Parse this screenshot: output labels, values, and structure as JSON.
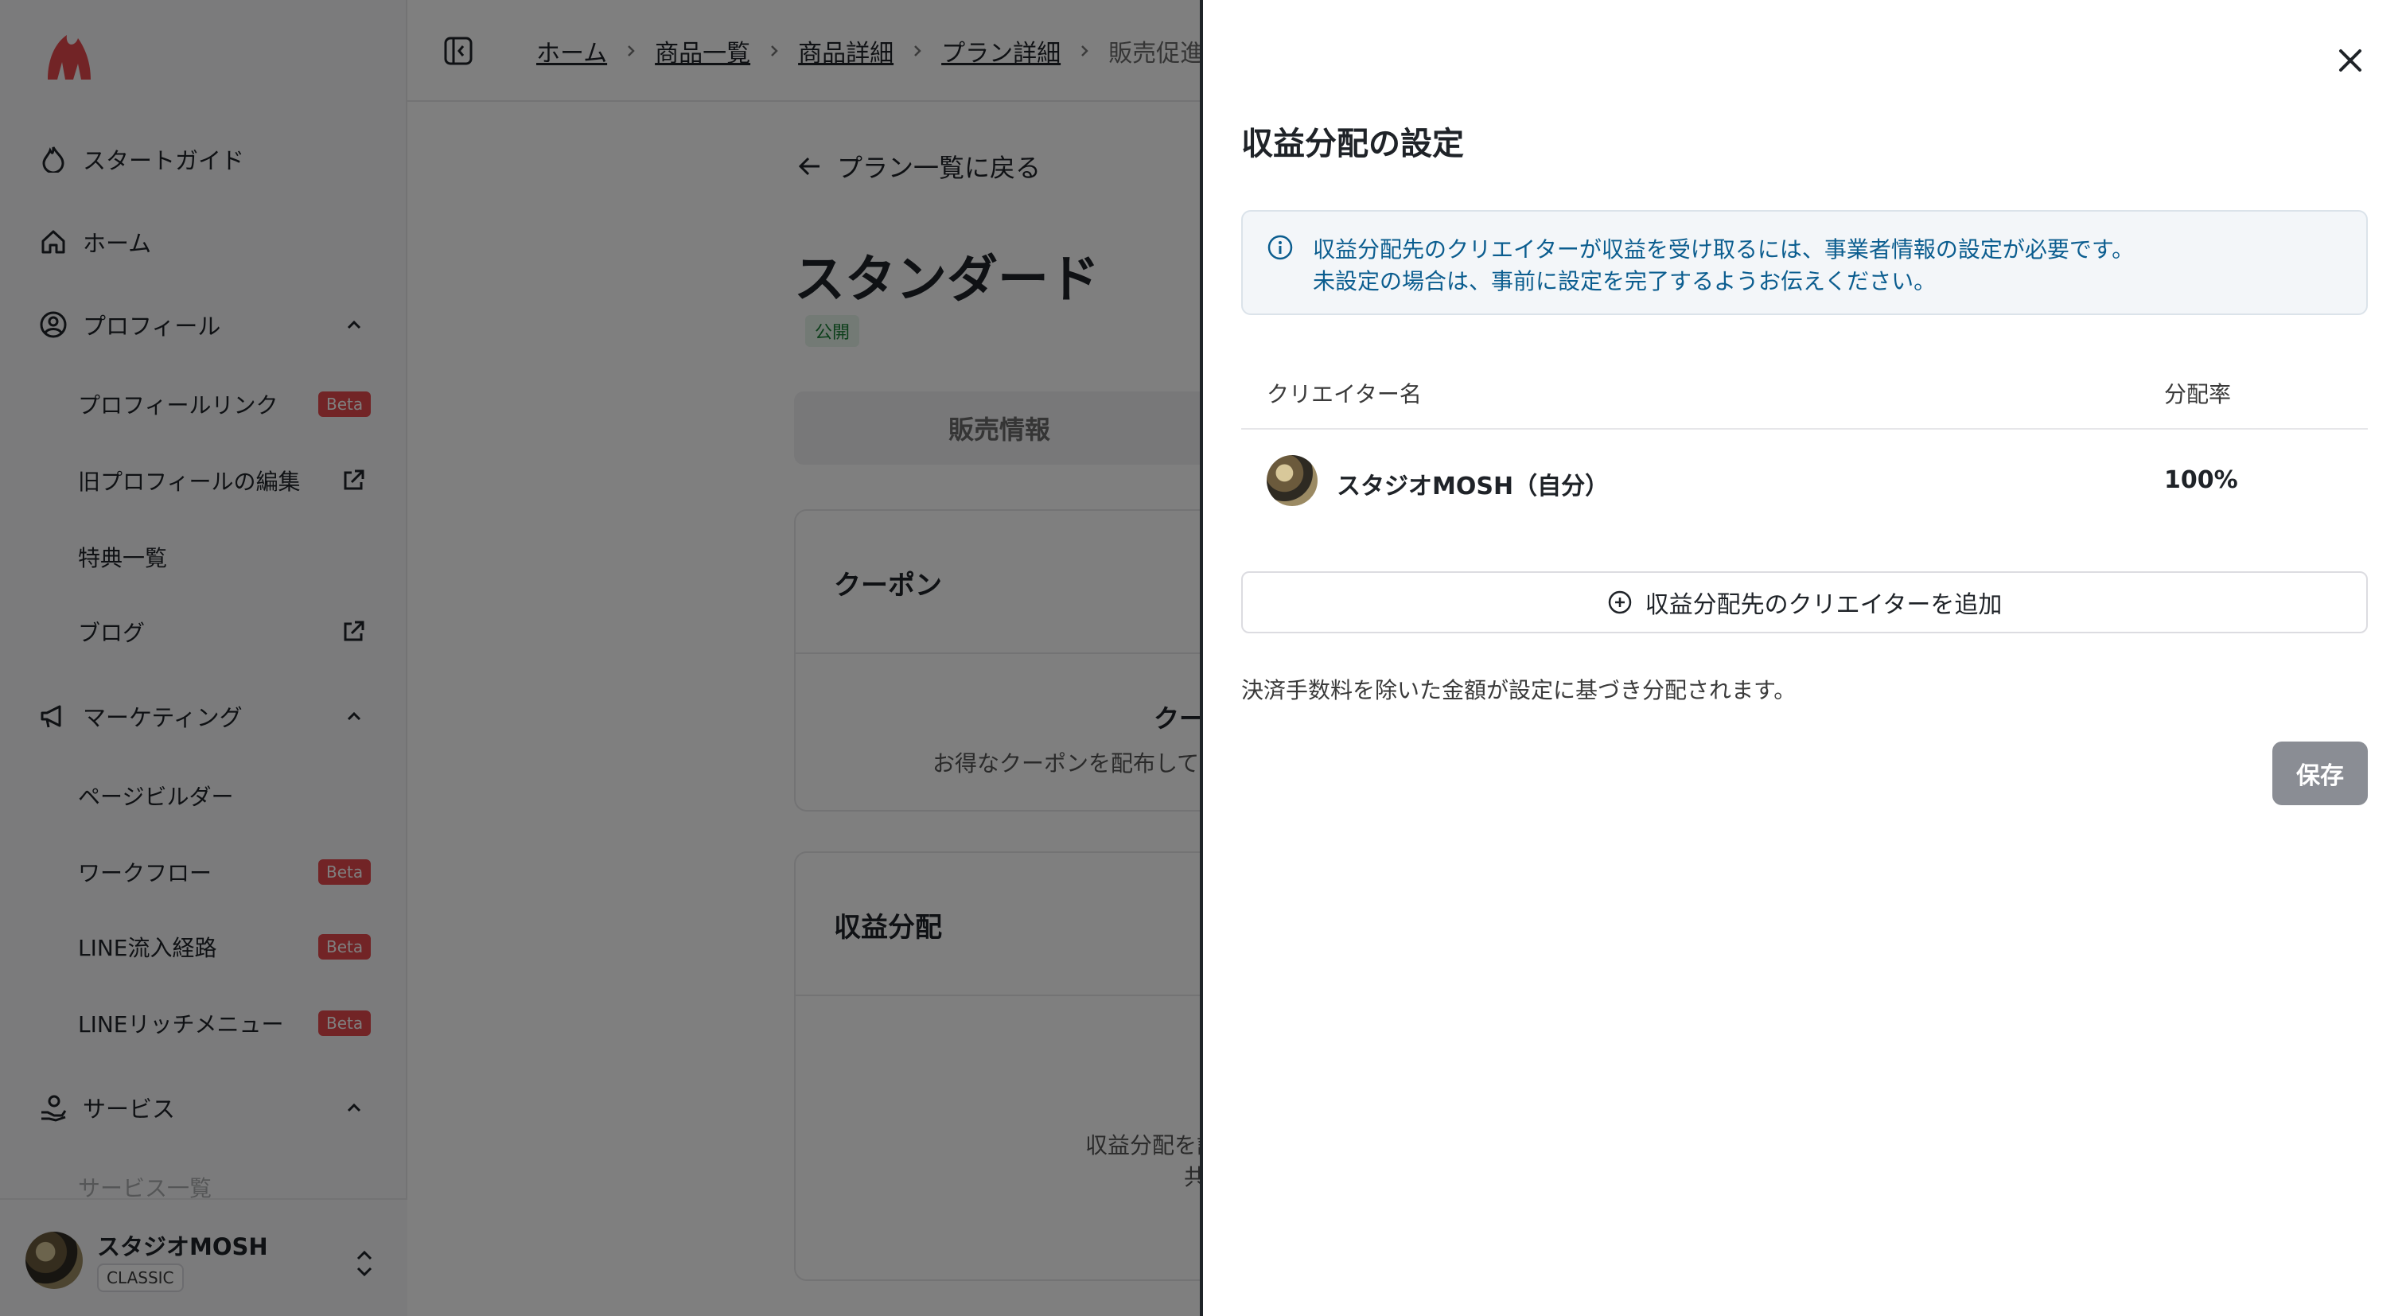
{
  "sidebar": {
    "items": [
      {
        "label": "スタートガイド",
        "icon": "flame-icon"
      },
      {
        "label": "ホーム",
        "icon": "home-icon"
      },
      {
        "label": "プロフィール",
        "icon": "user-circle-icon"
      },
      {
        "label": "プロフィールリンク",
        "badge": "Beta"
      },
      {
        "label": "旧プロフィールの編集",
        "icon": "external-link-icon"
      },
      {
        "label": "特典一覧"
      },
      {
        "label": "ブログ",
        "icon": "external-link-icon"
      },
      {
        "label": "マーケティング",
        "icon": "megaphone-icon"
      },
      {
        "label": "ページビルダー"
      },
      {
        "label": "ワークフロー",
        "badge": "Beta"
      },
      {
        "label": "LINE流入経路",
        "badge": "Beta"
      },
      {
        "label": "LINEリッチメニュー",
        "badge": "Beta"
      },
      {
        "label": "サービス",
        "icon": "hand-icon"
      },
      {
        "label": "サービス一覧"
      }
    ],
    "user": {
      "name": "スタジオMOSH",
      "plan": "CLASSIC"
    }
  },
  "breadcrumb": [
    "ホーム",
    "商品一覧",
    "商品詳細",
    "プラン詳細",
    "販売促進"
  ],
  "main": {
    "back_label": "プラン一覧に戻る",
    "plan_title": "スタンダード",
    "status": "公開",
    "tab_label": "販売情報",
    "coupon_title": "クーポン",
    "coupon_heading": "クーポ",
    "coupon_sub": "お得なクーポンを配布して",
    "revenue_title": "収益分配",
    "revenue_sub_1": "収益分配を設",
    "revenue_sub_2": "共"
  },
  "drawer": {
    "title": "収益分配の設定",
    "info_lines": [
      "収益分配先のクリエイターが収益を受け取るには、事業者情報の設定が必要です。",
      "未設定の場合は、事前に設定を完了するようお伝えください。"
    ],
    "table": {
      "headers": [
        "クリエイター名",
        "分配率"
      ],
      "rows": [
        {
          "name": "スタジオMOSH（自分）",
          "rate": "100%"
        }
      ]
    },
    "add_label": "収益分配先のクリエイターを追加",
    "note": "決済手数料を除いた金額が設定に基づき分配されます。",
    "save_label": "保存"
  },
  "colors": {
    "accent": "#0b5d8f",
    "brand": "#e5484d",
    "save_disabled": "#8a8d94"
  }
}
